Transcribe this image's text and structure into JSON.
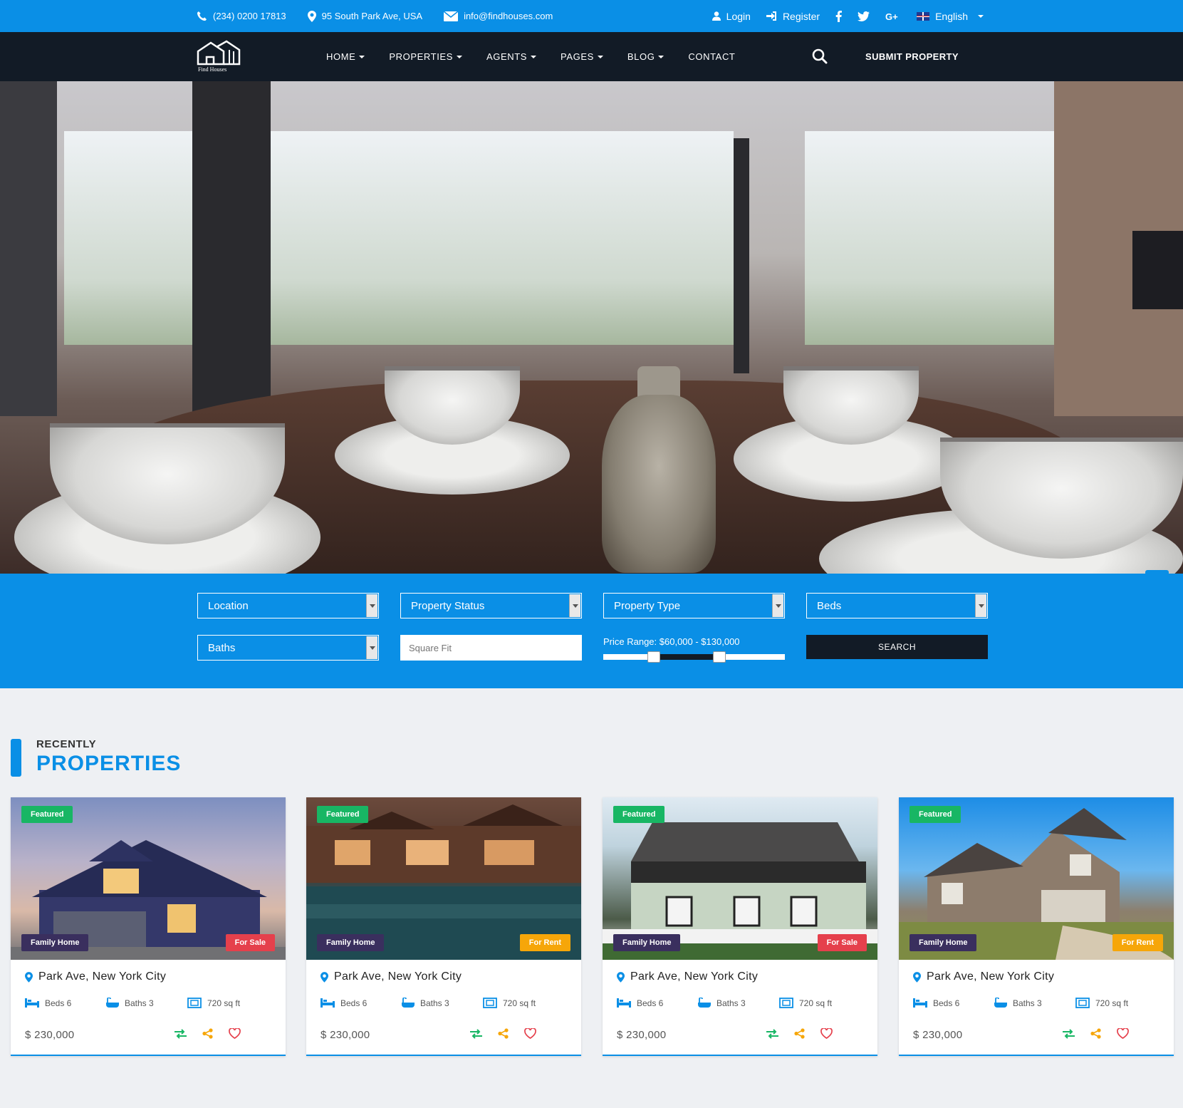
{
  "topbar": {
    "phone": "(234) 0200 17813",
    "address": "95 South Park Ave, USA",
    "email": "info@findhouses.com",
    "login": "Login",
    "register": "Register",
    "language": "English"
  },
  "nav": {
    "logo_text": "Find Houses",
    "items": [
      {
        "label": "HOME"
      },
      {
        "label": "PROPERTIES"
      },
      {
        "label": "AGENTS"
      },
      {
        "label": "PAGES"
      },
      {
        "label": "BLOG"
      },
      {
        "label": "CONTACT"
      }
    ],
    "submit": "SUBMIT PROPERTY"
  },
  "search": {
    "location": "Location",
    "status": "Property Status",
    "type": "Property Type",
    "beds": "Beds",
    "baths": "Baths",
    "square_ft_placeholder": "Square Fit",
    "price_range": "Price Range: $60,000 - $130,000",
    "price_range_low_fraction": 0.28,
    "price_range_high_fraction": 0.64,
    "button": "SEARCH"
  },
  "section": {
    "small": "RECENTLY",
    "big": "PROPERTIES"
  },
  "colors": {
    "primary": "#0a8fe6",
    "dark": "#121b26",
    "featured": "#18b664",
    "type_badge": "#3a2f5e",
    "for_sale": "#e5404c",
    "for_rent": "#f6a609"
  },
  "cards": [
    {
      "featured": "Featured",
      "type": "Family Home",
      "status": "For Sale",
      "address": "Park Ave, New York City",
      "beds": "Beds 6",
      "baths": "Baths 3",
      "area": "720 sq ft",
      "price": "$ 230,000"
    },
    {
      "featured": "Featured",
      "type": "Family Home",
      "status": "For Rent",
      "address": "Park Ave, New York City",
      "beds": "Beds 6",
      "baths": "Baths 3",
      "area": "720 sq ft",
      "price": "$ 230,000"
    },
    {
      "featured": "Featured",
      "type": "Family Home",
      "status": "For Sale",
      "address": "Park Ave, New York City",
      "beds": "Beds 6",
      "baths": "Baths 3",
      "area": "720 sq ft",
      "price": "$ 230,000"
    },
    {
      "featured": "Featured",
      "type": "Family Home",
      "status": "For Rent",
      "address": "Park Ave, New York City",
      "beds": "Beds 6",
      "baths": "Baths 3",
      "area": "720 sq ft",
      "price": "$ 230,000"
    }
  ]
}
